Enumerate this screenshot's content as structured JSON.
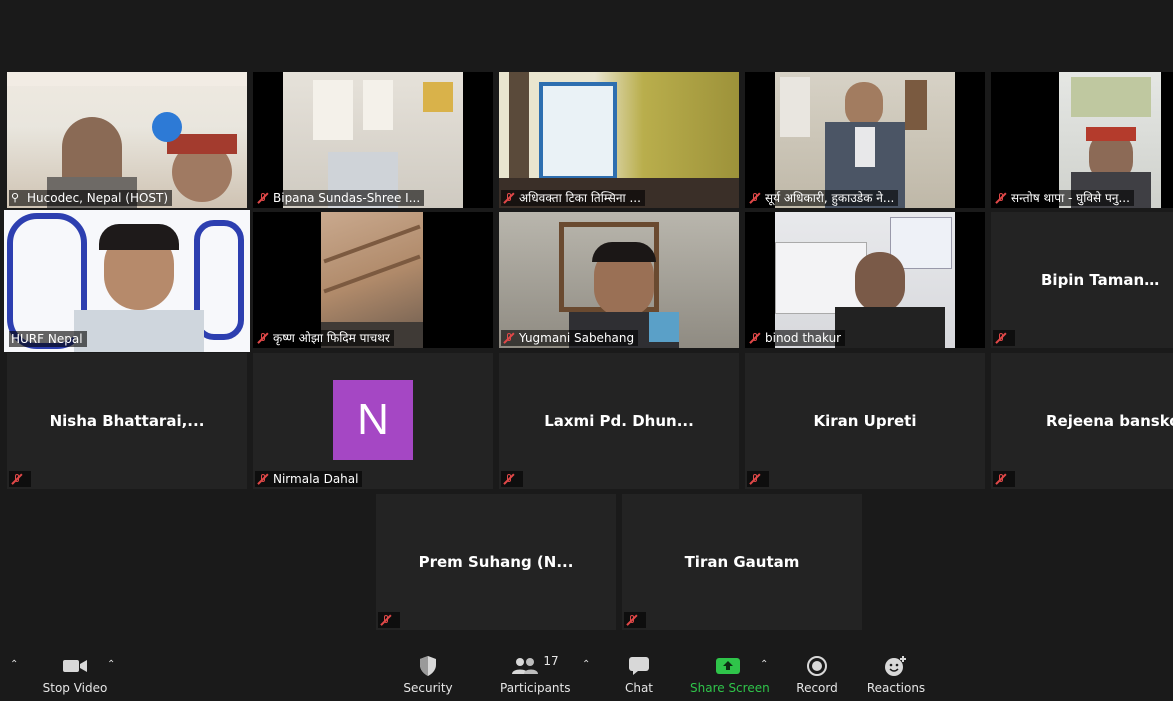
{
  "participants": [
    {
      "name": "Hucodec, Nepal (HOST)",
      "video": true,
      "host": true
    },
    {
      "name": "Bipana Sundas-Shree I...",
      "video": true
    },
    {
      "name": "अधिवक्ता टिका तिम्सिना ...",
      "video": true
    },
    {
      "name": "सूर्य अधिकारी, हुकाउडेक ने...",
      "video": true
    },
    {
      "name": "सन्तोष थापा  - घुविसे पनु...",
      "video": true
    },
    {
      "name": "HURF Nepal",
      "video": true,
      "speaking": true
    },
    {
      "name": "कृष्ण ओझा फिदिम पाचथर",
      "video": true
    },
    {
      "name": "Yugmani Sabehang",
      "video": true
    },
    {
      "name": "binod thakur",
      "video": true
    },
    {
      "name": "Bipin Tamang Cl...",
      "video": false
    },
    {
      "name": "Nisha Bhattarai,...",
      "video": false
    },
    {
      "name": "Nirmala Dahal",
      "video": false,
      "avatar_letter": "N",
      "avatar_color": "#a547c4"
    },
    {
      "name": "Laxmi Pd. Dhun...",
      "video": false
    },
    {
      "name": "Kiran Upreti",
      "video": false
    },
    {
      "name": "Rejeena banskota",
      "video": false
    },
    {
      "name": "Prem Suhang (N...",
      "video": false
    },
    {
      "name": "Tiran Gautam",
      "video": false
    }
  ],
  "toolbar": {
    "stop_video": "Stop Video",
    "security": "Security",
    "participants": "Participants",
    "participants_count": "17",
    "chat": "Chat",
    "share_screen": "Share Screen",
    "record": "Record",
    "reactions": "Reactions"
  },
  "colors": {
    "background": "#1a1a1a",
    "speaker_outline": "#d6e85a",
    "share_green": "#2fc44a",
    "mute_red": "#e04848"
  }
}
